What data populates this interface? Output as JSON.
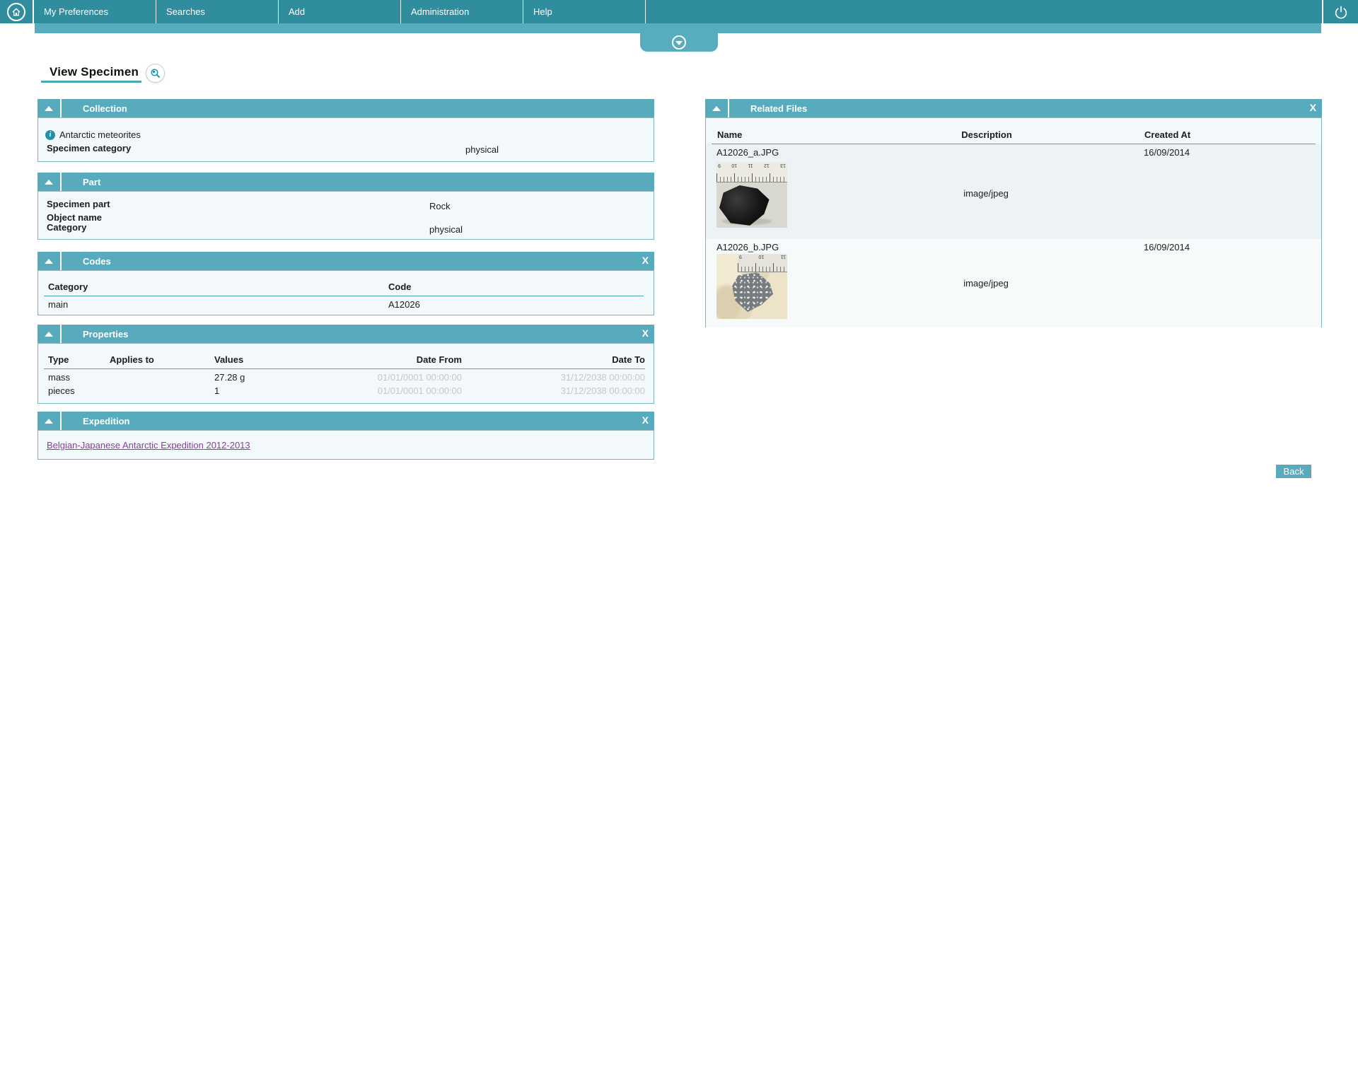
{
  "nav": {
    "items": [
      {
        "label": "My Preferences"
      },
      {
        "label": "Searches"
      },
      {
        "label": "Add"
      },
      {
        "label": "Administration"
      },
      {
        "label": "Help"
      }
    ]
  },
  "page": {
    "title": "View Specimen"
  },
  "icons": {
    "close": "X"
  },
  "panels": {
    "collection": {
      "title": "Collection",
      "info_text": "Antarctic meteorites",
      "fields": [
        {
          "label": "Specimen category",
          "value": "physical"
        }
      ]
    },
    "part": {
      "title": "Part",
      "fields": [
        {
          "label": "Specimen part",
          "value": "Rock"
        },
        {
          "label": "Object name",
          "value": ""
        },
        {
          "label": "Category",
          "value": "physical"
        }
      ]
    },
    "codes": {
      "title": "Codes",
      "columns": [
        "Category",
        "Code"
      ],
      "rows": [
        [
          "main",
          "A12026"
        ]
      ]
    },
    "properties": {
      "title": "Properties",
      "columns": [
        "Type",
        "Applies to",
        "Values",
        "Date From",
        "Date To"
      ],
      "rows": [
        [
          "mass",
          "",
          "27.28 g",
          "01/01/0001 00:00:00",
          "31/12/2038 00:00:00"
        ],
        [
          "pieces",
          "",
          "1",
          "01/01/0001 00:00:00",
          "31/12/2038 00:00:00"
        ]
      ]
    },
    "expedition": {
      "title": "Expedition",
      "link_text": "Belgian-Japanese Antarctic Expedition 2012-2013"
    },
    "related_files": {
      "title": "Related Files",
      "columns": [
        "Name",
        "Description",
        "Created At"
      ],
      "rows": [
        {
          "name": "A12026_a.JPG",
          "description": "image/jpeg",
          "created_at": "16/09/2014"
        },
        {
          "name": "A12026_b.JPG",
          "description": "image/jpeg",
          "created_at": "16/09/2014"
        }
      ]
    }
  },
  "buttons": {
    "back": "Back"
  },
  "colors": {
    "topbar": "#2F8D9E",
    "accent": "#58ABBD",
    "panel_body": "#F3F9FA",
    "header_rule": "#4BA5B6",
    "link": "#8A3D9C",
    "muted_date": "#C3C7C9",
    "info_icon": "#2193A8"
  }
}
